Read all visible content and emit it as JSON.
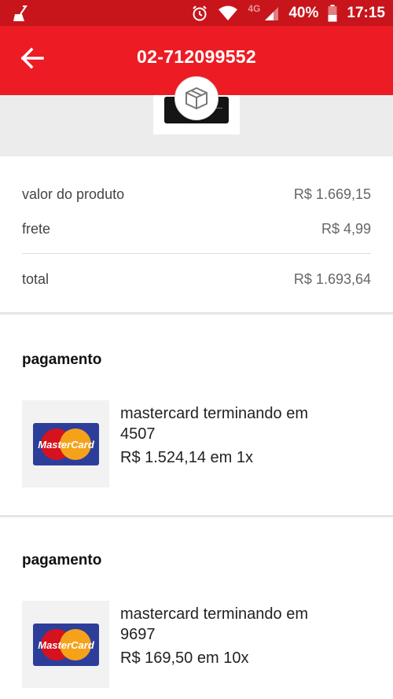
{
  "status_bar": {
    "network": "4G",
    "battery": "40%",
    "time": "17:15",
    "icons": [
      "broom-icon",
      "alarm-icon",
      "wifi-icon",
      "signal-icon",
      "battery-icon"
    ]
  },
  "app_bar": {
    "title": "02-712099552",
    "back_icon": "arrow-left-icon",
    "color": "#ed1c24"
  },
  "summary": {
    "product_label": "valor do produto",
    "product_value": "R$ 1.669,15",
    "shipping_label": "frete",
    "shipping_value": "R$ 4,99",
    "total_label": "total",
    "total_value": "R$ 1.693,64"
  },
  "payments": [
    {
      "title": "pagamento",
      "card_brand": "MasterCard",
      "description_line1": "mastercard terminando em",
      "description_line2": "4507",
      "amount": "R$ 1.524,14 em 1x"
    },
    {
      "title": "pagamento",
      "card_brand": "MasterCard",
      "description_line1": "mastercard terminando em",
      "description_line2": "9697",
      "amount": "R$ 169,50 em 10x"
    }
  ]
}
